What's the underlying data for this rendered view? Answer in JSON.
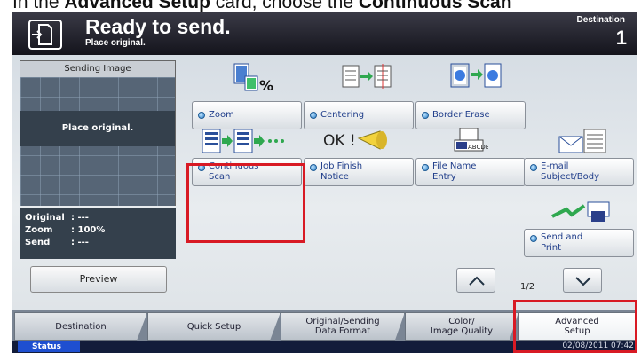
{
  "caption": {
    "prefix": "In the ",
    "bold1": "Advanced Setup",
    "middle": " card, choose the ",
    "bold2": "Continuous Scan"
  },
  "header": {
    "title": "Ready to send.",
    "subtitle": "Place original.",
    "destination_label": "Destination",
    "destination_count": "1"
  },
  "preview": {
    "title": "Sending Image",
    "message": "Place original."
  },
  "info": [
    {
      "key": "Original",
      "value": ": ---"
    },
    {
      "key": "Zoom",
      "value": ": 100%"
    },
    {
      "key": "Send",
      "value": ": ---"
    }
  ],
  "preview_button": "Preview",
  "functions": {
    "zoom": "Zoom",
    "centering": "Centering",
    "border_erase": "Border Erase",
    "continuous_scan_1": "Continuous",
    "continuous_scan_2": "Scan",
    "job_finish_1": "Job Finish",
    "job_finish_2": "Notice",
    "file_name_1": "File Name",
    "file_name_2": "Entry",
    "email_1": "E-mail",
    "email_2": "Subject/Body",
    "send_print_1": "Send and",
    "send_print_2": "Print"
  },
  "icon_text": {
    "percent": "%",
    "ok": "OK !",
    "abc": "ABCDE"
  },
  "pager": {
    "indicator": "1/2"
  },
  "tabs": [
    {
      "line1": "Destination",
      "line2": ""
    },
    {
      "line1": "Quick Setup",
      "line2": ""
    },
    {
      "line1": "Original/Sending",
      "line2": "Data Format"
    },
    {
      "line1": "Color/",
      "line2": "Image Quality"
    },
    {
      "line1": "Advanced",
      "line2": "Setup"
    }
  ],
  "status": {
    "label": "Status",
    "datetime": "02/08/2011   07:42"
  },
  "colors": {
    "highlight": "#d81a24",
    "header_bg": "#1e1e28",
    "button_text": "#1f3d8a"
  }
}
